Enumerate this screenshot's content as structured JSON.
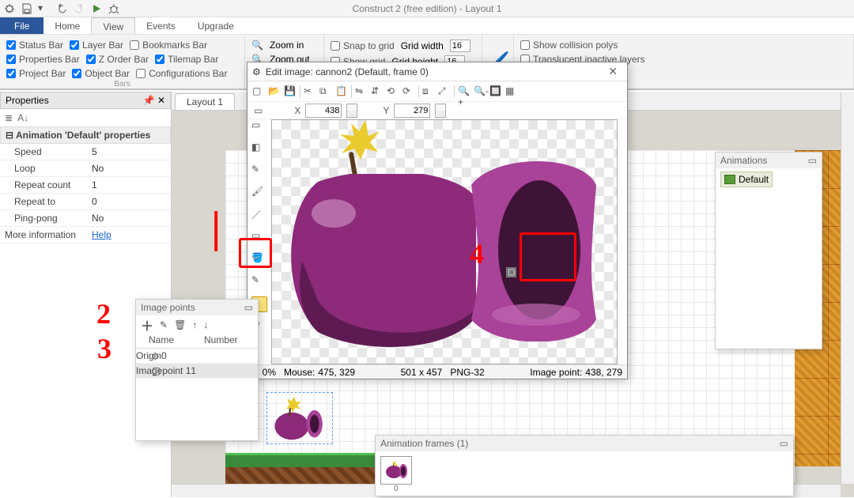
{
  "app_title": "Construct 2  (free edition) - Layout 1",
  "menu": {
    "file": "File",
    "home": "Home",
    "view": "View",
    "events": "Events",
    "upgrade": "Upgrade"
  },
  "ribbon": {
    "bars": {
      "title": "Bars",
      "status": "Status Bar",
      "properties": "Properties Bar",
      "project": "Project Bar",
      "layer": "Layer Bar",
      "zorder": "Z Order Bar",
      "object": "Object Bar",
      "bookmarks": "Bookmarks Bar",
      "tilemap": "Tilemap Bar",
      "configs": "Configurations Bar"
    },
    "zoom": {
      "in": "Zoom in",
      "out": "Zoom out"
    },
    "grid": {
      "snap": "Snap to grid",
      "show": "Show grid",
      "wlabel": "Grid width",
      "hlabel": "Grid height",
      "w": "16",
      "h": "16"
    },
    "display": {
      "polys": "Show collision polys",
      "transl": "Translucent inactive layers"
    }
  },
  "properties": {
    "panel": "Properties",
    "section": "Animation 'Default' properties",
    "rows": [
      {
        "k": "Speed",
        "v": "5"
      },
      {
        "k": "Loop",
        "v": "No"
      },
      {
        "k": "Repeat count",
        "v": "1"
      },
      {
        "k": "Repeat to",
        "v": "0"
      },
      {
        "k": "Ping-pong",
        "v": "No"
      }
    ],
    "moreinfo": "More information",
    "help": "Help"
  },
  "layout_tab": "Layout 1",
  "imedit": {
    "title": "Edit image: cannon2 (Default, frame 0)",
    "x_label": "X",
    "y_label": "Y",
    "x": "438",
    "y": "279",
    "status": {
      "zoom": "0%",
      "mouse_label": "Mouse:",
      "mouse": "475, 329",
      "size": "501 x 457",
      "fmt": "PNG-32",
      "ip_label": "Image point:",
      "ip": "438, 279"
    }
  },
  "imagepoints": {
    "title": "Image points",
    "cols": {
      "name": "Name",
      "num": "Number"
    },
    "rows": [
      {
        "icon": "◇",
        "name": "Origin",
        "num": "0"
      },
      {
        "icon": "▢",
        "name": "Imagepoint 1",
        "num": "1"
      }
    ]
  },
  "anim_frames": {
    "title": "Animation frames (1)",
    "indices": [
      "0"
    ]
  },
  "animations": {
    "title": "Animations",
    "items": [
      "Default"
    ]
  }
}
